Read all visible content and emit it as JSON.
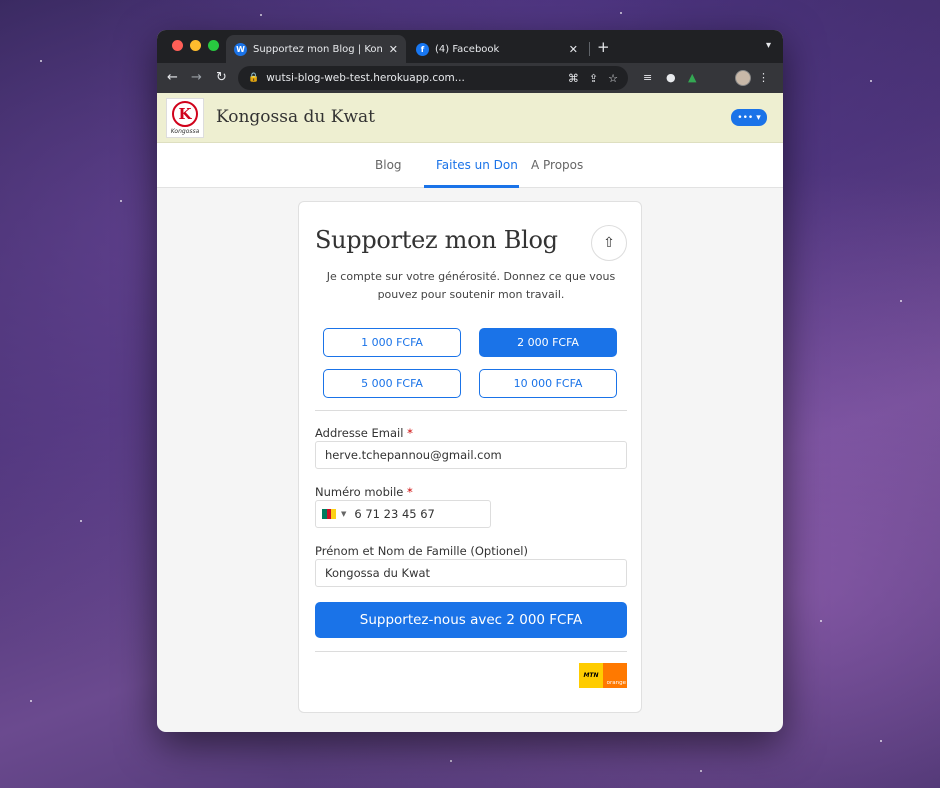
{
  "browser": {
    "tabs": [
      {
        "title": "Supportez mon Blog | Kongossa",
        "favicon": "W",
        "active": true
      },
      {
        "title": "(4) Facebook",
        "favicon": "f",
        "active": false
      }
    ],
    "new_tab": "+",
    "url": "wutsi-blog-web-test.herokuapp.com..."
  },
  "site": {
    "title": "Kongossa du Kwat",
    "logo_text": "Kongossa",
    "logo_letter": "K",
    "more_label": "•••"
  },
  "nav": {
    "tabs": [
      "Blog",
      "Faites un Don",
      "A Propos"
    ],
    "active": "Faites un Don"
  },
  "card": {
    "title": "Supportez mon Blog",
    "description": "Je compte sur votre générosité. Donnez ce que vous pouvez pour soutenir mon travail.",
    "amounts": [
      "1 000 FCFA",
      "2 000 FCFA",
      "5 000 FCFA",
      "10 000 FCFA"
    ],
    "selected_amount": "2 000 FCFA",
    "email_label": "Addresse Email",
    "email_value": "herve.tchepannou@gmail.com",
    "phone_label": "Numéro mobile",
    "phone_value": "6 71 23 45 67",
    "name_label": "Prénom et Nom de Famille (Optionel)",
    "name_value": "Kongossa du Kwat",
    "required_mark": "*",
    "submit_label": "Supportez-nous avec 2 000 FCFA",
    "payment_logos": {
      "mtn": "MTN",
      "orange": "orange"
    }
  },
  "colors": {
    "accent": "#1a73e8",
    "header_bg": "#eeefd1",
    "logo_red": "#d0021b"
  }
}
